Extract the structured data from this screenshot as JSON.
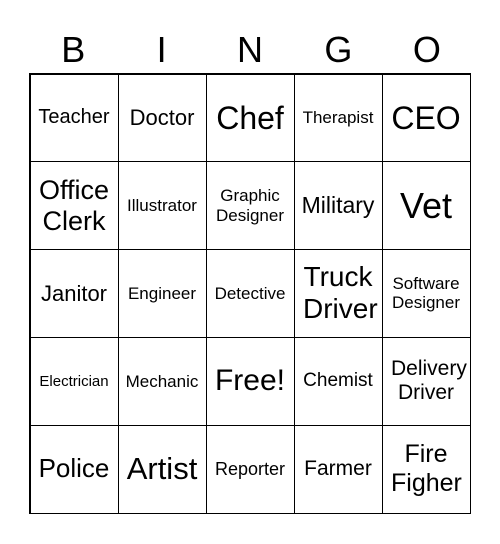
{
  "header": [
    "B",
    "I",
    "N",
    "G",
    "O"
  ],
  "cells": [
    "Teacher",
    "Doctor",
    "Chef",
    "Therapist",
    "CEO",
    "Office Clerk",
    "Illustrator",
    "Graphic Designer",
    "Military",
    "Vet",
    "Janitor",
    "Engineer",
    "Detective",
    "Truck Driver",
    "Software Designer",
    "Electrician",
    "Mechanic",
    "Free!",
    "Chemist",
    "Delivery Driver",
    "Police",
    "Artist",
    "Reporter",
    "Farmer",
    "Fire Figher"
  ]
}
